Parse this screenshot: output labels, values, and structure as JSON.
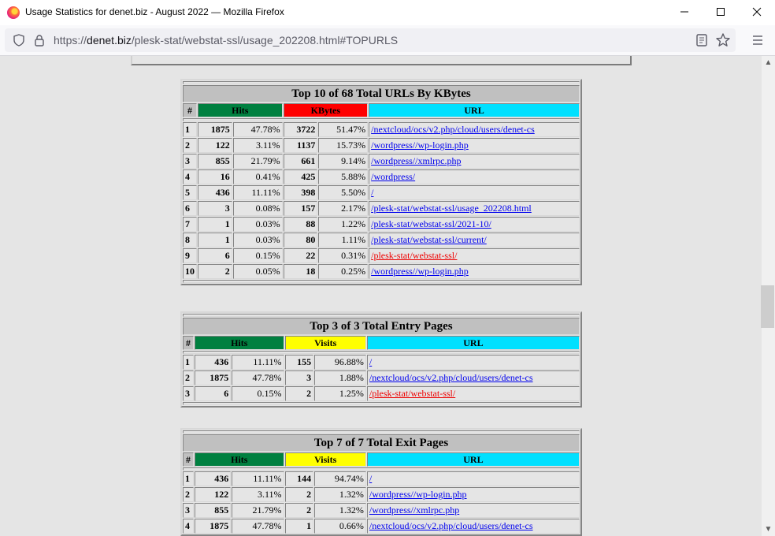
{
  "window": {
    "title": "Usage Statistics for denet.biz - August 2022 — Mozilla Firefox"
  },
  "nav": {
    "url_prefix": "https://",
    "url_host": "denet.biz",
    "url_path": "/plesk-stat/webstat-ssl/usage_202208.html#TOPURLS"
  },
  "colors": {
    "hits": "#008040",
    "kbytes": "#ff0000",
    "visits": "#ffff00",
    "url": "#00e0ff"
  },
  "urls_table": {
    "caption": "Top 10 of 68 Total URLs By KBytes",
    "headers": {
      "rank": "#",
      "hits": "Hits",
      "kbytes": "KBytes",
      "url": "URL"
    },
    "rows": [
      {
        "rank": "1",
        "hits": "1875",
        "hits_pct": "47.78%",
        "kb": "3722",
        "kb_pct": "51.47%",
        "url": "/nextcloud/ocs/v2.php/cloud/users/denet-cs",
        "red": false
      },
      {
        "rank": "2",
        "hits": "122",
        "hits_pct": "3.11%",
        "kb": "1137",
        "kb_pct": "15.73%",
        "url": "/wordpress//wp-login.php",
        "red": false
      },
      {
        "rank": "3",
        "hits": "855",
        "hits_pct": "21.79%",
        "kb": "661",
        "kb_pct": "9.14%",
        "url": "/wordpress//xmlrpc.php",
        "red": false
      },
      {
        "rank": "4",
        "hits": "16",
        "hits_pct": "0.41%",
        "kb": "425",
        "kb_pct": "5.88%",
        "url": "/wordpress/",
        "red": false
      },
      {
        "rank": "5",
        "hits": "436",
        "hits_pct": "11.11%",
        "kb": "398",
        "kb_pct": "5.50%",
        "url": "/",
        "red": false
      },
      {
        "rank": "6",
        "hits": "3",
        "hits_pct": "0.08%",
        "kb": "157",
        "kb_pct": "2.17%",
        "url": "/plesk-stat/webstat-ssl/usage_202208.html",
        "red": false
      },
      {
        "rank": "7",
        "hits": "1",
        "hits_pct": "0.03%",
        "kb": "88",
        "kb_pct": "1.22%",
        "url": "/plesk-stat/webstat-ssl/2021-10/",
        "red": false
      },
      {
        "rank": "8",
        "hits": "1",
        "hits_pct": "0.03%",
        "kb": "80",
        "kb_pct": "1.11%",
        "url": "/plesk-stat/webstat-ssl/current/",
        "red": false
      },
      {
        "rank": "9",
        "hits": "6",
        "hits_pct": "0.15%",
        "kb": "22",
        "kb_pct": "0.31%",
        "url": "/plesk-stat/webstat-ssl/",
        "red": true
      },
      {
        "rank": "10",
        "hits": "2",
        "hits_pct": "0.05%",
        "kb": "18",
        "kb_pct": "0.25%",
        "url": "/wordpress//wp-login.php",
        "red": false
      }
    ]
  },
  "entry_table": {
    "caption": "Top 3 of 3 Total Entry Pages",
    "headers": {
      "rank": "#",
      "hits": "Hits",
      "visits": "Visits",
      "url": "URL"
    },
    "rows": [
      {
        "rank": "1",
        "hits": "436",
        "hits_pct": "11.11%",
        "v": "155",
        "v_pct": "96.88%",
        "url": "/",
        "red": false
      },
      {
        "rank": "2",
        "hits": "1875",
        "hits_pct": "47.78%",
        "v": "3",
        "v_pct": "1.88%",
        "url": "/nextcloud/ocs/v2.php/cloud/users/denet-cs",
        "red": false
      },
      {
        "rank": "3",
        "hits": "6",
        "hits_pct": "0.15%",
        "v": "2",
        "v_pct": "1.25%",
        "url": "/plesk-stat/webstat-ssl/",
        "red": true
      }
    ]
  },
  "exit_table": {
    "caption": "Top 7 of 7 Total Exit Pages",
    "headers": {
      "rank": "#",
      "hits": "Hits",
      "visits": "Visits",
      "url": "URL"
    },
    "rows": [
      {
        "rank": "1",
        "hits": "436",
        "hits_pct": "11.11%",
        "v": "144",
        "v_pct": "94.74%",
        "url": "/",
        "red": false
      },
      {
        "rank": "2",
        "hits": "122",
        "hits_pct": "3.11%",
        "v": "2",
        "v_pct": "1.32%",
        "url": "/wordpress//wp-login.php",
        "red": false
      },
      {
        "rank": "3",
        "hits": "855",
        "hits_pct": "21.79%",
        "v": "2",
        "v_pct": "1.32%",
        "url": "/wordpress//xmlrpc.php",
        "red": false
      },
      {
        "rank": "4",
        "hits": "1875",
        "hits_pct": "47.78%",
        "v": "1",
        "v_pct": "0.66%",
        "url": "/nextcloud/ocs/v2.php/cloud/users/denet-cs",
        "red": false
      }
    ]
  }
}
